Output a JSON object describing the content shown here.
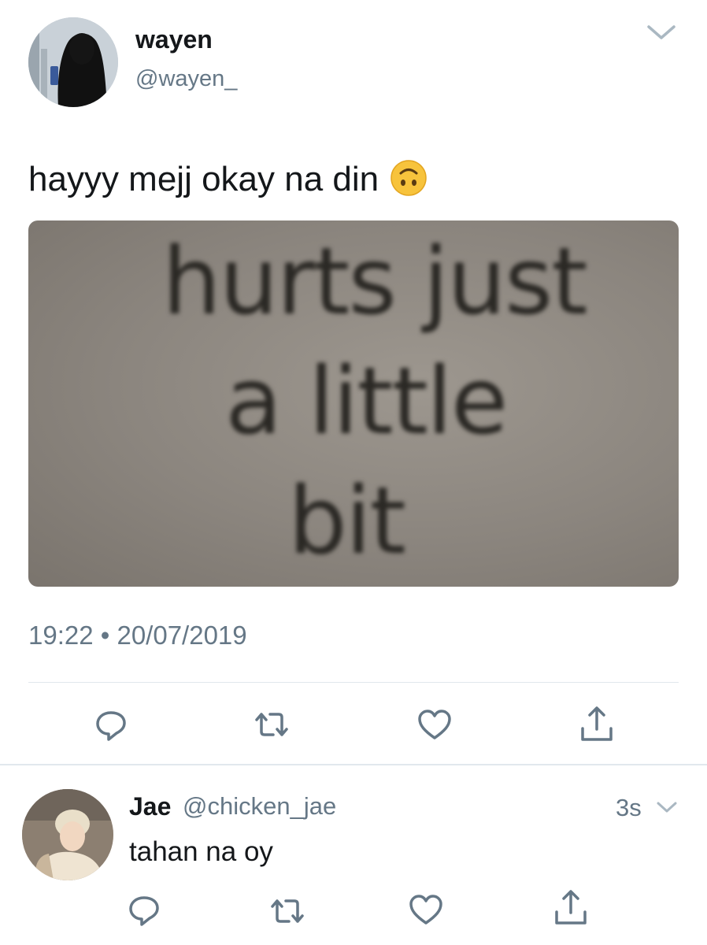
{
  "tweet": {
    "author": {
      "name": "wayen",
      "handle": "@wayen_"
    },
    "text": "hayyy mejj okay na din",
    "emoji": "upside-down-face-emoji",
    "media": {
      "lines": [
        "hurts just",
        "a little",
        "bit"
      ]
    },
    "timestamp": "19:22 • 20/07/2019",
    "actions": [
      "reply-icon",
      "retweet-icon",
      "like-icon",
      "share-icon"
    ]
  },
  "reply": {
    "author": {
      "name": "Jae",
      "handle": "@chicken_jae"
    },
    "time": "3s",
    "text": "tahan na oy",
    "actions": [
      "reply-icon",
      "retweet-icon",
      "like-icon",
      "share-icon"
    ]
  },
  "colors": {
    "text_primary": "#14171a",
    "text_secondary": "#657786",
    "icon": "#657786",
    "divider": "#e1e8ed",
    "emoji_yellow": "#f7c33c"
  }
}
